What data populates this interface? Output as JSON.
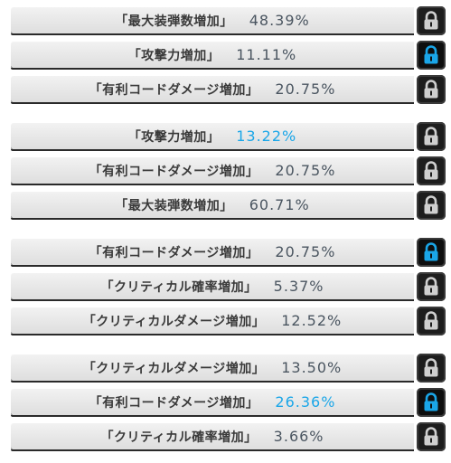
{
  "groups": [
    {
      "rows": [
        {
          "label": "「最大装弾数増加」",
          "value": "48.39%",
          "highlight": false,
          "locked": false
        },
        {
          "label": "「攻撃力増加」",
          "value": "11.11%",
          "highlight": false,
          "locked": true
        },
        {
          "label": "「有利コードダメージ増加」",
          "value": "20.75%",
          "highlight": false,
          "locked": false
        }
      ]
    },
    {
      "rows": [
        {
          "label": "「攻撃力増加」",
          "value": "13.22%",
          "highlight": true,
          "locked": false
        },
        {
          "label": "「有利コードダメージ増加」",
          "value": "20.75%",
          "highlight": false,
          "locked": false
        },
        {
          "label": "「最大装弾数増加」",
          "value": "60.71%",
          "highlight": false,
          "locked": false
        }
      ]
    },
    {
      "rows": [
        {
          "label": "「有利コードダメージ増加」",
          "value": "20.75%",
          "highlight": false,
          "locked": true
        },
        {
          "label": "「クリティカル確率増加」",
          "value": "5.37%",
          "highlight": false,
          "locked": false
        },
        {
          "label": "「クリティカルダメージ増加」",
          "value": "12.52%",
          "highlight": false,
          "locked": false
        }
      ]
    },
    {
      "rows": [
        {
          "label": "「クリティカルダメージ増加」",
          "value": "13.50%",
          "highlight": false,
          "locked": false
        },
        {
          "label": "「有利コードダメージ増加」",
          "value": "26.36%",
          "highlight": true,
          "locked": true
        },
        {
          "label": "「クリティカル確率増加」",
          "value": "3.66%",
          "highlight": false,
          "locked": false
        }
      ]
    }
  ],
  "colors": {
    "highlight": "#1aa6e8",
    "value": "#4a5560",
    "label": "#3a3a3a",
    "lock_on": "#1aa6e8",
    "lock_off": "#cfcfcf"
  },
  "icons": {
    "lock_open": "unlocked-padlock-icon",
    "lock_closed": "locked-padlock-icon"
  }
}
